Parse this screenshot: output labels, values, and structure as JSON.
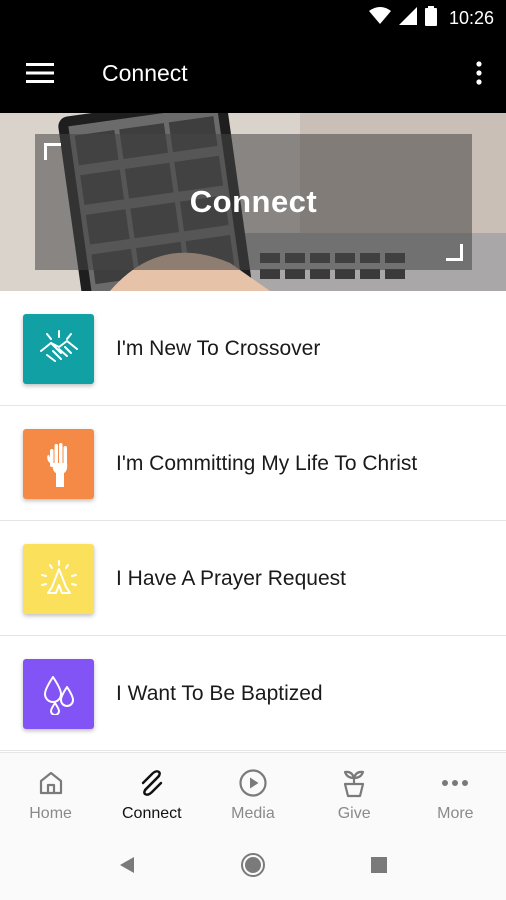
{
  "status_bar": {
    "time": "10:26",
    "icons": [
      "wifi-icon",
      "signal-icon",
      "battery-icon"
    ]
  },
  "app_bar": {
    "title": "Connect",
    "menu_icon": "hamburger-menu-icon",
    "overflow_icon": "more-vert-icon"
  },
  "hero": {
    "title": "Connect"
  },
  "list": {
    "items": [
      {
        "label": "I'm New To Crossover",
        "icon": "handshake-icon",
        "color": "#11a0a4"
      },
      {
        "label": "I'm Committing My Life To Christ",
        "icon": "raised-hand-icon",
        "color": "#f58a46"
      },
      {
        "label": "I Have A Prayer Request",
        "icon": "praying-hands-icon",
        "color": "#fbe05b"
      },
      {
        "label": "I Want To Be Baptized",
        "icon": "water-drops-icon",
        "color": "#8354f5"
      }
    ]
  },
  "bottom_nav": {
    "active": "Connect",
    "tabs": [
      {
        "label": "Home",
        "icon": "home-icon"
      },
      {
        "label": "Connect",
        "icon": "connect-icon"
      },
      {
        "label": "Media",
        "icon": "play-circle-icon"
      },
      {
        "label": "Give",
        "icon": "plant-icon"
      },
      {
        "label": "More",
        "icon": "more-horiz-icon"
      }
    ]
  },
  "system_nav": {
    "buttons": [
      "back-icon",
      "home-circle-icon",
      "recents-icon"
    ]
  }
}
